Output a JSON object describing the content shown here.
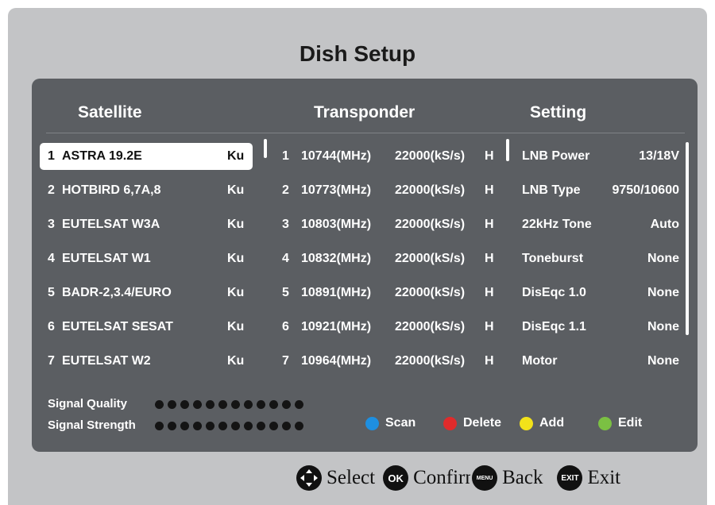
{
  "title": "Dish Setup",
  "columns": {
    "satellite": "Satellite",
    "transponder": "Transponder",
    "setting": "Setting"
  },
  "satellites": [
    {
      "num": "1",
      "name": "ASTRA 19.2E",
      "band": "Ku",
      "selected": true
    },
    {
      "num": "2",
      "name": "HOTBIRD 6,7A,8",
      "band": "Ku"
    },
    {
      "num": "3",
      "name": "EUTELSAT W3A",
      "band": "Ku"
    },
    {
      "num": "4",
      "name": "EUTELSAT W1",
      "band": "Ku"
    },
    {
      "num": "5",
      "name": "BADR-2,3.4/EURO",
      "band": "Ku"
    },
    {
      "num": "6",
      "name": "EUTELSAT SESAT",
      "band": "Ku"
    },
    {
      "num": "7",
      "name": "EUTELSAT W2",
      "band": "Ku"
    }
  ],
  "transponders": [
    {
      "num": "1",
      "freq": "10744(MHz)",
      "rate": "22000(kS/s)",
      "pol": "H"
    },
    {
      "num": "2",
      "freq": "10773(MHz)",
      "rate": "22000(kS/s)",
      "pol": "H"
    },
    {
      "num": "3",
      "freq": "10803(MHz)",
      "rate": "22000(kS/s)",
      "pol": "H"
    },
    {
      "num": "4",
      "freq": "10832(MHz)",
      "rate": "22000(kS/s)",
      "pol": "H"
    },
    {
      "num": "5",
      "freq": "10891(MHz)",
      "rate": "22000(kS/s)",
      "pol": "H"
    },
    {
      "num": "6",
      "freq": "10921(MHz)",
      "rate": "22000(kS/s)",
      "pol": "H"
    },
    {
      "num": "7",
      "freq": "10964(MHz)",
      "rate": "22000(kS/s)",
      "pol": "H"
    }
  ],
  "settings": [
    {
      "label": "LNB Power",
      "value": "13/18V"
    },
    {
      "label": "LNB Type",
      "value": "9750/10600"
    },
    {
      "label": "22kHz Tone",
      "value": "Auto"
    },
    {
      "label": "Toneburst",
      "value": "None"
    },
    {
      "label": "DisEqc 1.0",
      "value": "None"
    },
    {
      "label": "DisEqc 1.1",
      "value": "None"
    },
    {
      "label": "Motor",
      "value": "None"
    }
  ],
  "signal": {
    "quality_label": "Signal Quality",
    "strength_label": "Signal Strength",
    "quality_level": 0,
    "strength_level": 0
  },
  "color_keys": {
    "scan": {
      "label": "Scan",
      "color": "#1e8fe0"
    },
    "delete": {
      "label": "Delete",
      "color": "#e02b2b"
    },
    "add": {
      "label": "Add",
      "color": "#f2e21a"
    },
    "edit": {
      "label": "Edit",
      "color": "#7bc043"
    }
  },
  "footer": {
    "select": "Select",
    "ok_key": "OK",
    "confirm": "Confirm",
    "menu_key": "MENU",
    "back": "Back",
    "exit_key": "EXIT",
    "exit": "Exit"
  }
}
